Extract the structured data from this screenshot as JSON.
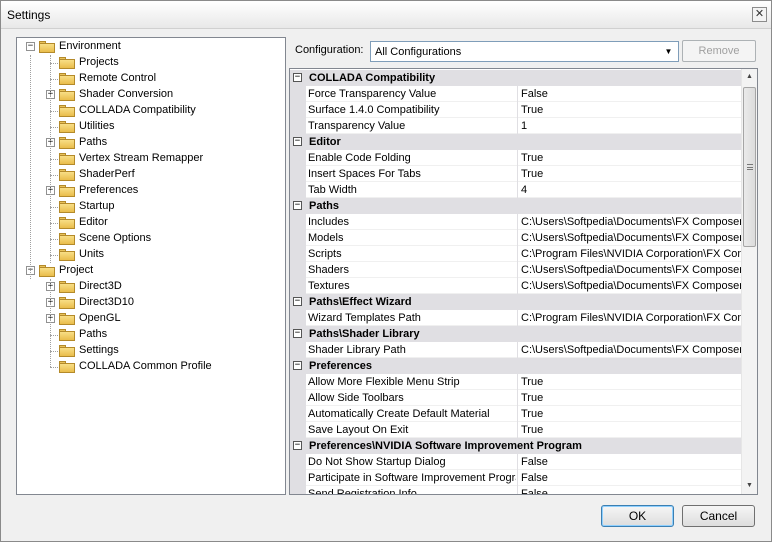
{
  "window": {
    "title": "Settings",
    "close_glyph": "✕"
  },
  "tree": {
    "items": [
      {
        "label": "Environment",
        "level": 0,
        "expander": "−",
        "open": true
      },
      {
        "label": "Projects",
        "level": 1,
        "expander": ""
      },
      {
        "label": "Remote Control",
        "level": 1,
        "expander": ""
      },
      {
        "label": "Shader Conversion",
        "level": 1,
        "expander": "+"
      },
      {
        "label": "COLLADA Compatibility",
        "level": 1,
        "expander": ""
      },
      {
        "label": "Utilities",
        "level": 1,
        "expander": ""
      },
      {
        "label": "Paths",
        "level": 1,
        "expander": "+"
      },
      {
        "label": "Vertex Stream Remapper",
        "level": 1,
        "expander": ""
      },
      {
        "label": "ShaderPerf",
        "level": 1,
        "expander": ""
      },
      {
        "label": "Preferences",
        "level": 1,
        "expander": "+"
      },
      {
        "label": "Startup",
        "level": 1,
        "expander": ""
      },
      {
        "label": "Editor",
        "level": 1,
        "expander": ""
      },
      {
        "label": "Scene Options",
        "level": 1,
        "expander": ""
      },
      {
        "label": "Units",
        "level": 1,
        "expander": ""
      },
      {
        "label": "Project",
        "level": 0,
        "expander": "−",
        "open": false
      },
      {
        "label": "Direct3D",
        "level": 1,
        "expander": "+"
      },
      {
        "label": "Direct3D10",
        "level": 1,
        "expander": "+"
      },
      {
        "label": "OpenGL",
        "level": 1,
        "expander": "+"
      },
      {
        "label": "Paths",
        "level": 1,
        "expander": ""
      },
      {
        "label": "Settings",
        "level": 1,
        "expander": ""
      },
      {
        "label": "COLLADA Common Profile",
        "level": 1,
        "expander": ""
      }
    ]
  },
  "config": {
    "label": "Configuration:",
    "selected": "All Configurations",
    "arrow": "▼",
    "remove_label": "Remove"
  },
  "grid": {
    "categories": [
      {
        "name": "COLLADA Compatibility",
        "props": [
          {
            "name": "Force Transparency Value",
            "value": "False"
          },
          {
            "name": "Surface 1.4.0 Compatibility",
            "value": "True"
          },
          {
            "name": "Transparency Value",
            "value": "1"
          }
        ]
      },
      {
        "name": "Editor",
        "props": [
          {
            "name": "Enable Code Folding",
            "value": "True"
          },
          {
            "name": "Insert Spaces For Tabs",
            "value": "True"
          },
          {
            "name": "Tab Width",
            "value": "4"
          }
        ]
      },
      {
        "name": "Paths",
        "props": [
          {
            "name": "Includes",
            "value": "C:\\Users\\Softpedia\\Documents\\FX Composer"
          },
          {
            "name": "Models",
            "value": "C:\\Users\\Softpedia\\Documents\\FX Composer"
          },
          {
            "name": "Scripts",
            "value": "C:\\Program Files\\NVIDIA Corporation\\FX Comp"
          },
          {
            "name": "Shaders",
            "value": "C:\\Users\\Softpedia\\Documents\\FX Composer"
          },
          {
            "name": "Textures",
            "value": "C:\\Users\\Softpedia\\Documents\\FX Composer"
          }
        ]
      },
      {
        "name": "Paths\\Effect Wizard",
        "props": [
          {
            "name": "Wizard Templates Path",
            "value": "C:\\Program Files\\NVIDIA Corporation\\FX Comp"
          }
        ]
      },
      {
        "name": "Paths\\Shader Library",
        "props": [
          {
            "name": "Shader Library Path",
            "value": "C:\\Users\\Softpedia\\Documents\\FX Composer"
          }
        ]
      },
      {
        "name": "Preferences",
        "props": [
          {
            "name": "Allow More Flexible Menu Strip",
            "value": "True"
          },
          {
            "name": "Allow Side Toolbars",
            "value": "True"
          },
          {
            "name": "Automatically Create Default Material",
            "value": "True"
          },
          {
            "name": "Save Layout On Exit",
            "value": "True"
          }
        ]
      },
      {
        "name": "Preferences\\NVIDIA Software Improvement Program",
        "props": [
          {
            "name": "Do Not Show Startup Dialog",
            "value": "False"
          },
          {
            "name": "Participate in Software Improvement Program",
            "value": "False"
          },
          {
            "name": "Send Registration Info",
            "value": "False"
          }
        ]
      }
    ],
    "toggle_glyph": "−",
    "scroll_up": "▲",
    "scroll_down": "▼"
  },
  "buttons": {
    "ok": "OK",
    "cancel": "Cancel"
  }
}
